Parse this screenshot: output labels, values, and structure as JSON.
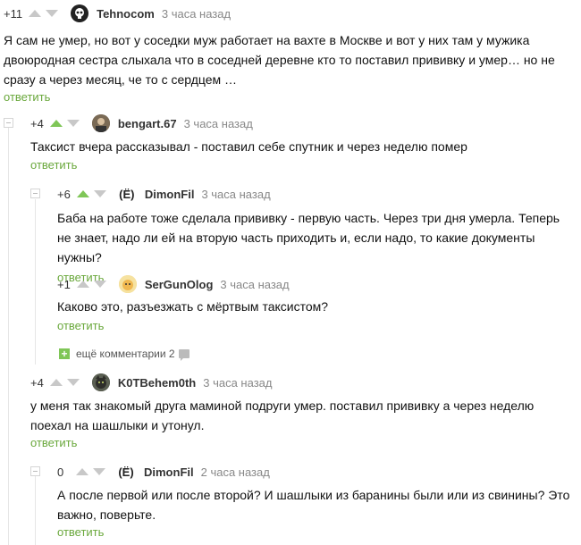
{
  "comments": [
    {
      "rating": "+11",
      "up_green": false,
      "username": "Tehnocom",
      "time": "3 часа назад",
      "avatar_color": "#222222",
      "avatar_icon": "skull-icon",
      "text": "Я сам не умер, но вот у соседки муж работает на вахте в Москве и вот у них там у мужика двоюродная сестра слыхала что в соседней деревне кто то поставил прививку и умер… но не сразу а через месяц, че то с сердцем …",
      "reply": "ответить"
    },
    {
      "rating": "+4",
      "up_green": true,
      "username": "bengart.67",
      "time": "3 часа назад",
      "avatar_color": "#6b5a4a",
      "avatar_icon": "portrait-icon",
      "text": "Таксист вчера рассказывал - поставил себе спутник и через неделю помер",
      "reply": "ответить"
    },
    {
      "rating": "+6",
      "up_green": true,
      "username": "DimonFil",
      "time": "3 часа назад",
      "avatar_color": "#ffffff",
      "avatar_glyph": "(Ё)",
      "avatar_icon": "letter-yo-icon",
      "text": "Баба на работе тоже сделала прививку - первую часть. Через три дня умерла. Теперь не знает, надо ли ей на вторую часть приходить и, если надо, то какие документы нужны?",
      "reply": "ответить"
    },
    {
      "rating": "+1",
      "up_green": false,
      "username": "SerGunOlog",
      "time": "3 часа назад",
      "avatar_color": "#f2d27a",
      "avatar_icon": "cartoon-icon",
      "text": "Каково это, разъезжать с мёртвым таксистом?",
      "reply": "ответить"
    },
    {
      "rating": "+4",
      "up_green": false,
      "username": "K0TBehem0th",
      "time": "3 часа назад",
      "avatar_color": "#4a4f45",
      "avatar_icon": "cat-icon",
      "text": "у меня так знакомый друга маминой подруги умер. поставил прививку а через неделю поехал на шашлыки и утонул.",
      "reply": "ответить"
    },
    {
      "rating": "0",
      "up_green": false,
      "username": "DimonFil",
      "time": "2 часа назад",
      "avatar_color": "#ffffff",
      "avatar_glyph": "(Ё)",
      "avatar_icon": "letter-yo-icon",
      "text": "А после первой или после второй? И шашлыки из баранины были или из свинины? Это важно, поверьте.",
      "reply": "ответить"
    }
  ],
  "more_comments": {
    "label": "ещё комментарии 2",
    "plus": "+"
  }
}
